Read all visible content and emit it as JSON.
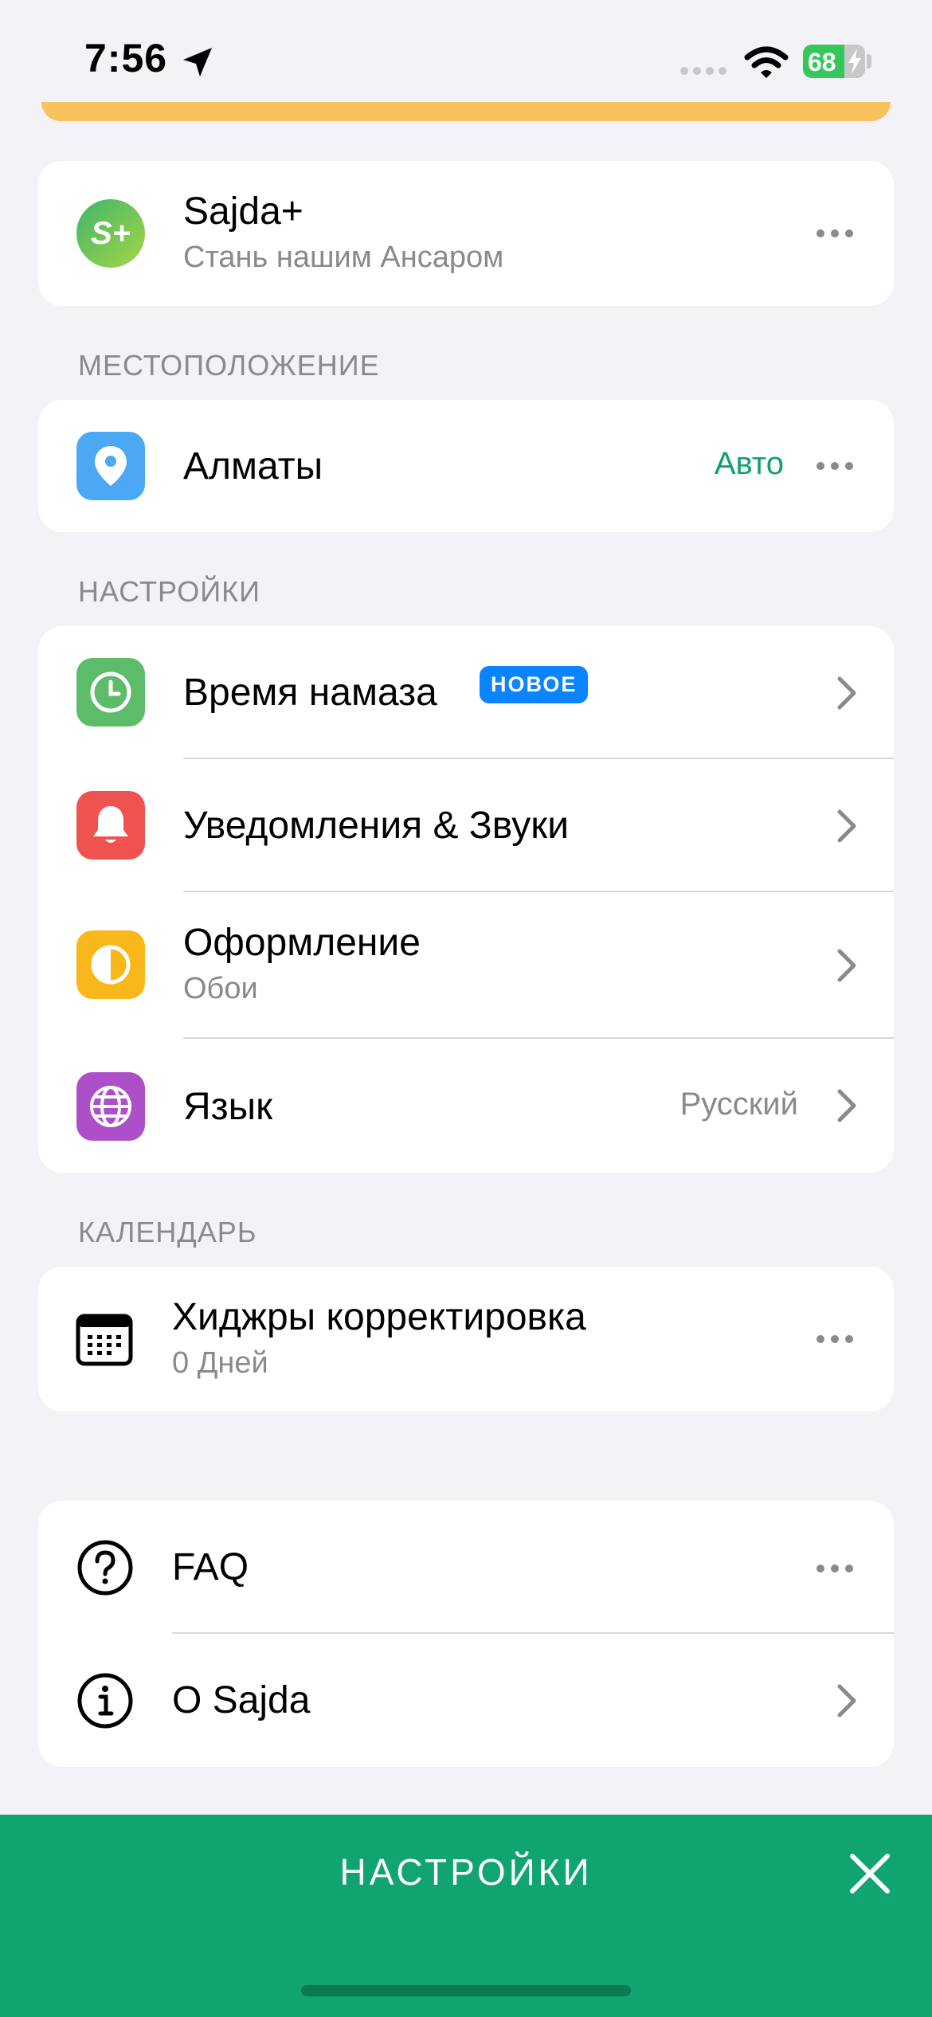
{
  "status_bar": {
    "time": "7:56",
    "battery": "68"
  },
  "premium": {
    "title": "Sajda+",
    "subtitle": "Стань нашим Ансаром",
    "icon_text": "S+"
  },
  "location": {
    "header": "МЕСТОПОЛОЖЕНИЕ",
    "city": "Алматы",
    "mode": "Авто"
  },
  "settings": {
    "header": "НАСТРОЙКИ",
    "items": [
      {
        "label": "Время намаза",
        "badge": "НОВОЕ"
      },
      {
        "label": "Уведомления & Звуки"
      },
      {
        "label": "Оформление",
        "subtitle": "Обои"
      },
      {
        "label": "Язык",
        "value": "Русский"
      }
    ]
  },
  "calendar": {
    "header": "КАЛЕНДАРЬ",
    "title": "Хиджры корректировка",
    "subtitle": "0 Дней"
  },
  "info": {
    "items": [
      {
        "label": "FAQ"
      },
      {
        "label": "О Sajda"
      }
    ]
  },
  "bottom": {
    "title": "НАСТРОЙКИ"
  },
  "colors": {
    "accent_green": "#10a56f",
    "badge_blue": "#0a84ff",
    "location_blue": "#4aa8f5",
    "clock_green": "#5cbc6a",
    "bell_red": "#ef5350",
    "theme_yellow": "#f8b81c",
    "globe_purple": "#ac4fc8",
    "strip_yellow": "#f9c25c"
  }
}
